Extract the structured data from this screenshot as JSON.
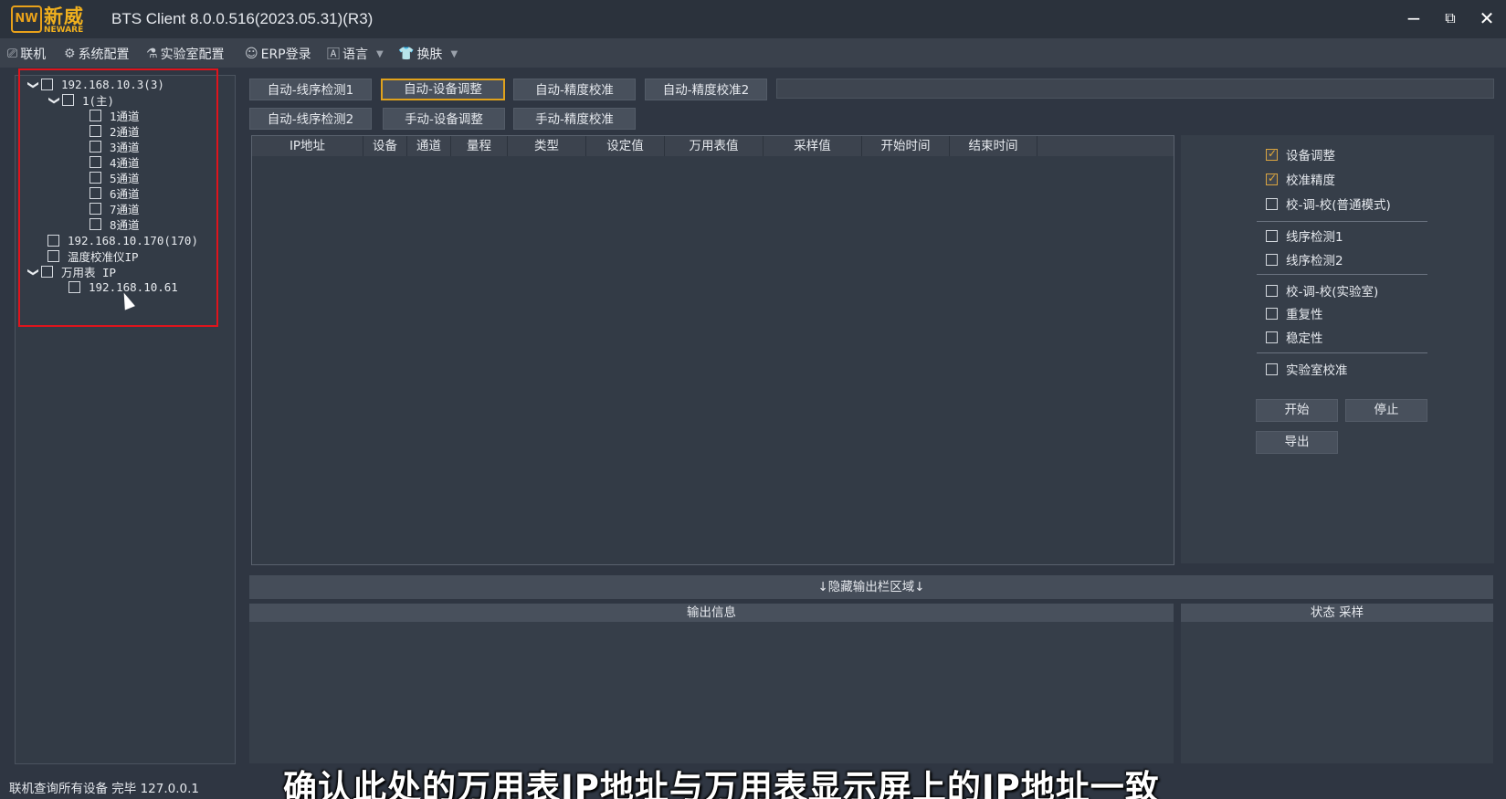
{
  "window": {
    "title": "BTS Client 8.0.0.516(2023.05.31)(R3)",
    "logo_cn": "新威",
    "logo_en": "NEWARE",
    "logo_mark": "NW",
    "minimize": "−",
    "restore": "⧉",
    "close": "✕"
  },
  "menu": {
    "items": [
      {
        "icon": "⎚",
        "label": "联机"
      },
      {
        "icon": "⚙",
        "label": "系统配置"
      },
      {
        "icon": "⚗",
        "label": "实验室配置"
      },
      {
        "icon": "☺",
        "label": "ERP登录"
      },
      {
        "icon": "🄰",
        "label": "语言"
      },
      {
        "icon": "👕",
        "label": "换肤"
      }
    ]
  },
  "tree": {
    "nodes": [
      {
        "label": "192.168.10.3(3)",
        "expanded": true
      },
      {
        "label": "1(主)",
        "expanded": true
      },
      {
        "label": "1通道"
      },
      {
        "label": "2通道"
      },
      {
        "label": "3通道"
      },
      {
        "label": "4通道"
      },
      {
        "label": "5通道"
      },
      {
        "label": "6通道"
      },
      {
        "label": "7通道"
      },
      {
        "label": "8通道"
      },
      {
        "label": "192.168.10.170(170)"
      },
      {
        "label": "温度校准仪IP"
      },
      {
        "label": "万用表 IP",
        "expanded": true
      },
      {
        "label": "192.168.10.61"
      }
    ]
  },
  "tabs": {
    "row1": [
      "自动-线序检测1",
      "自动-设备调整",
      "自动-精度校准",
      "自动-精度校准2"
    ],
    "row2": [
      "自动-线序检测2",
      "手动-设备调整",
      "手动-精度校准"
    ],
    "active": "自动-设备调整"
  },
  "table": {
    "columns": [
      "IP地址",
      "设备",
      "通道",
      "量程",
      "类型",
      "设定值",
      "万用表值",
      "采样值",
      "开始时间",
      "结束时间"
    ]
  },
  "options": {
    "items": [
      {
        "label": "设备调整",
        "checked": true
      },
      {
        "label": "校准精度",
        "checked": true
      },
      {
        "label": "校-调-校(普通模式)",
        "checked": false
      },
      {
        "label": "线序检测1",
        "checked": false
      },
      {
        "label": "线序检测2",
        "checked": false
      },
      {
        "label": "校-调-校(实验室)",
        "checked": false
      },
      {
        "label": "重复性",
        "checked": false
      },
      {
        "label": "稳定性",
        "checked": false
      },
      {
        "label": "实验室校准",
        "checked": false
      }
    ],
    "buttons": {
      "start": "开始",
      "stop": "停止",
      "export": "导出"
    }
  },
  "hide_bar": "↓隐藏输出栏区域↓",
  "output": {
    "info_title": "输出信息",
    "status_title": "状态 采样"
  },
  "status": {
    "text": "联机查询所有设备 完毕 127.0.0.1"
  },
  "subtitle": "确认此处的万用表IP地址与万用表显示屏上的IP地址一致",
  "colors": {
    "accent": "#e0a21c",
    "highlight_box": "#e0141c",
    "background": "#2f3642"
  }
}
